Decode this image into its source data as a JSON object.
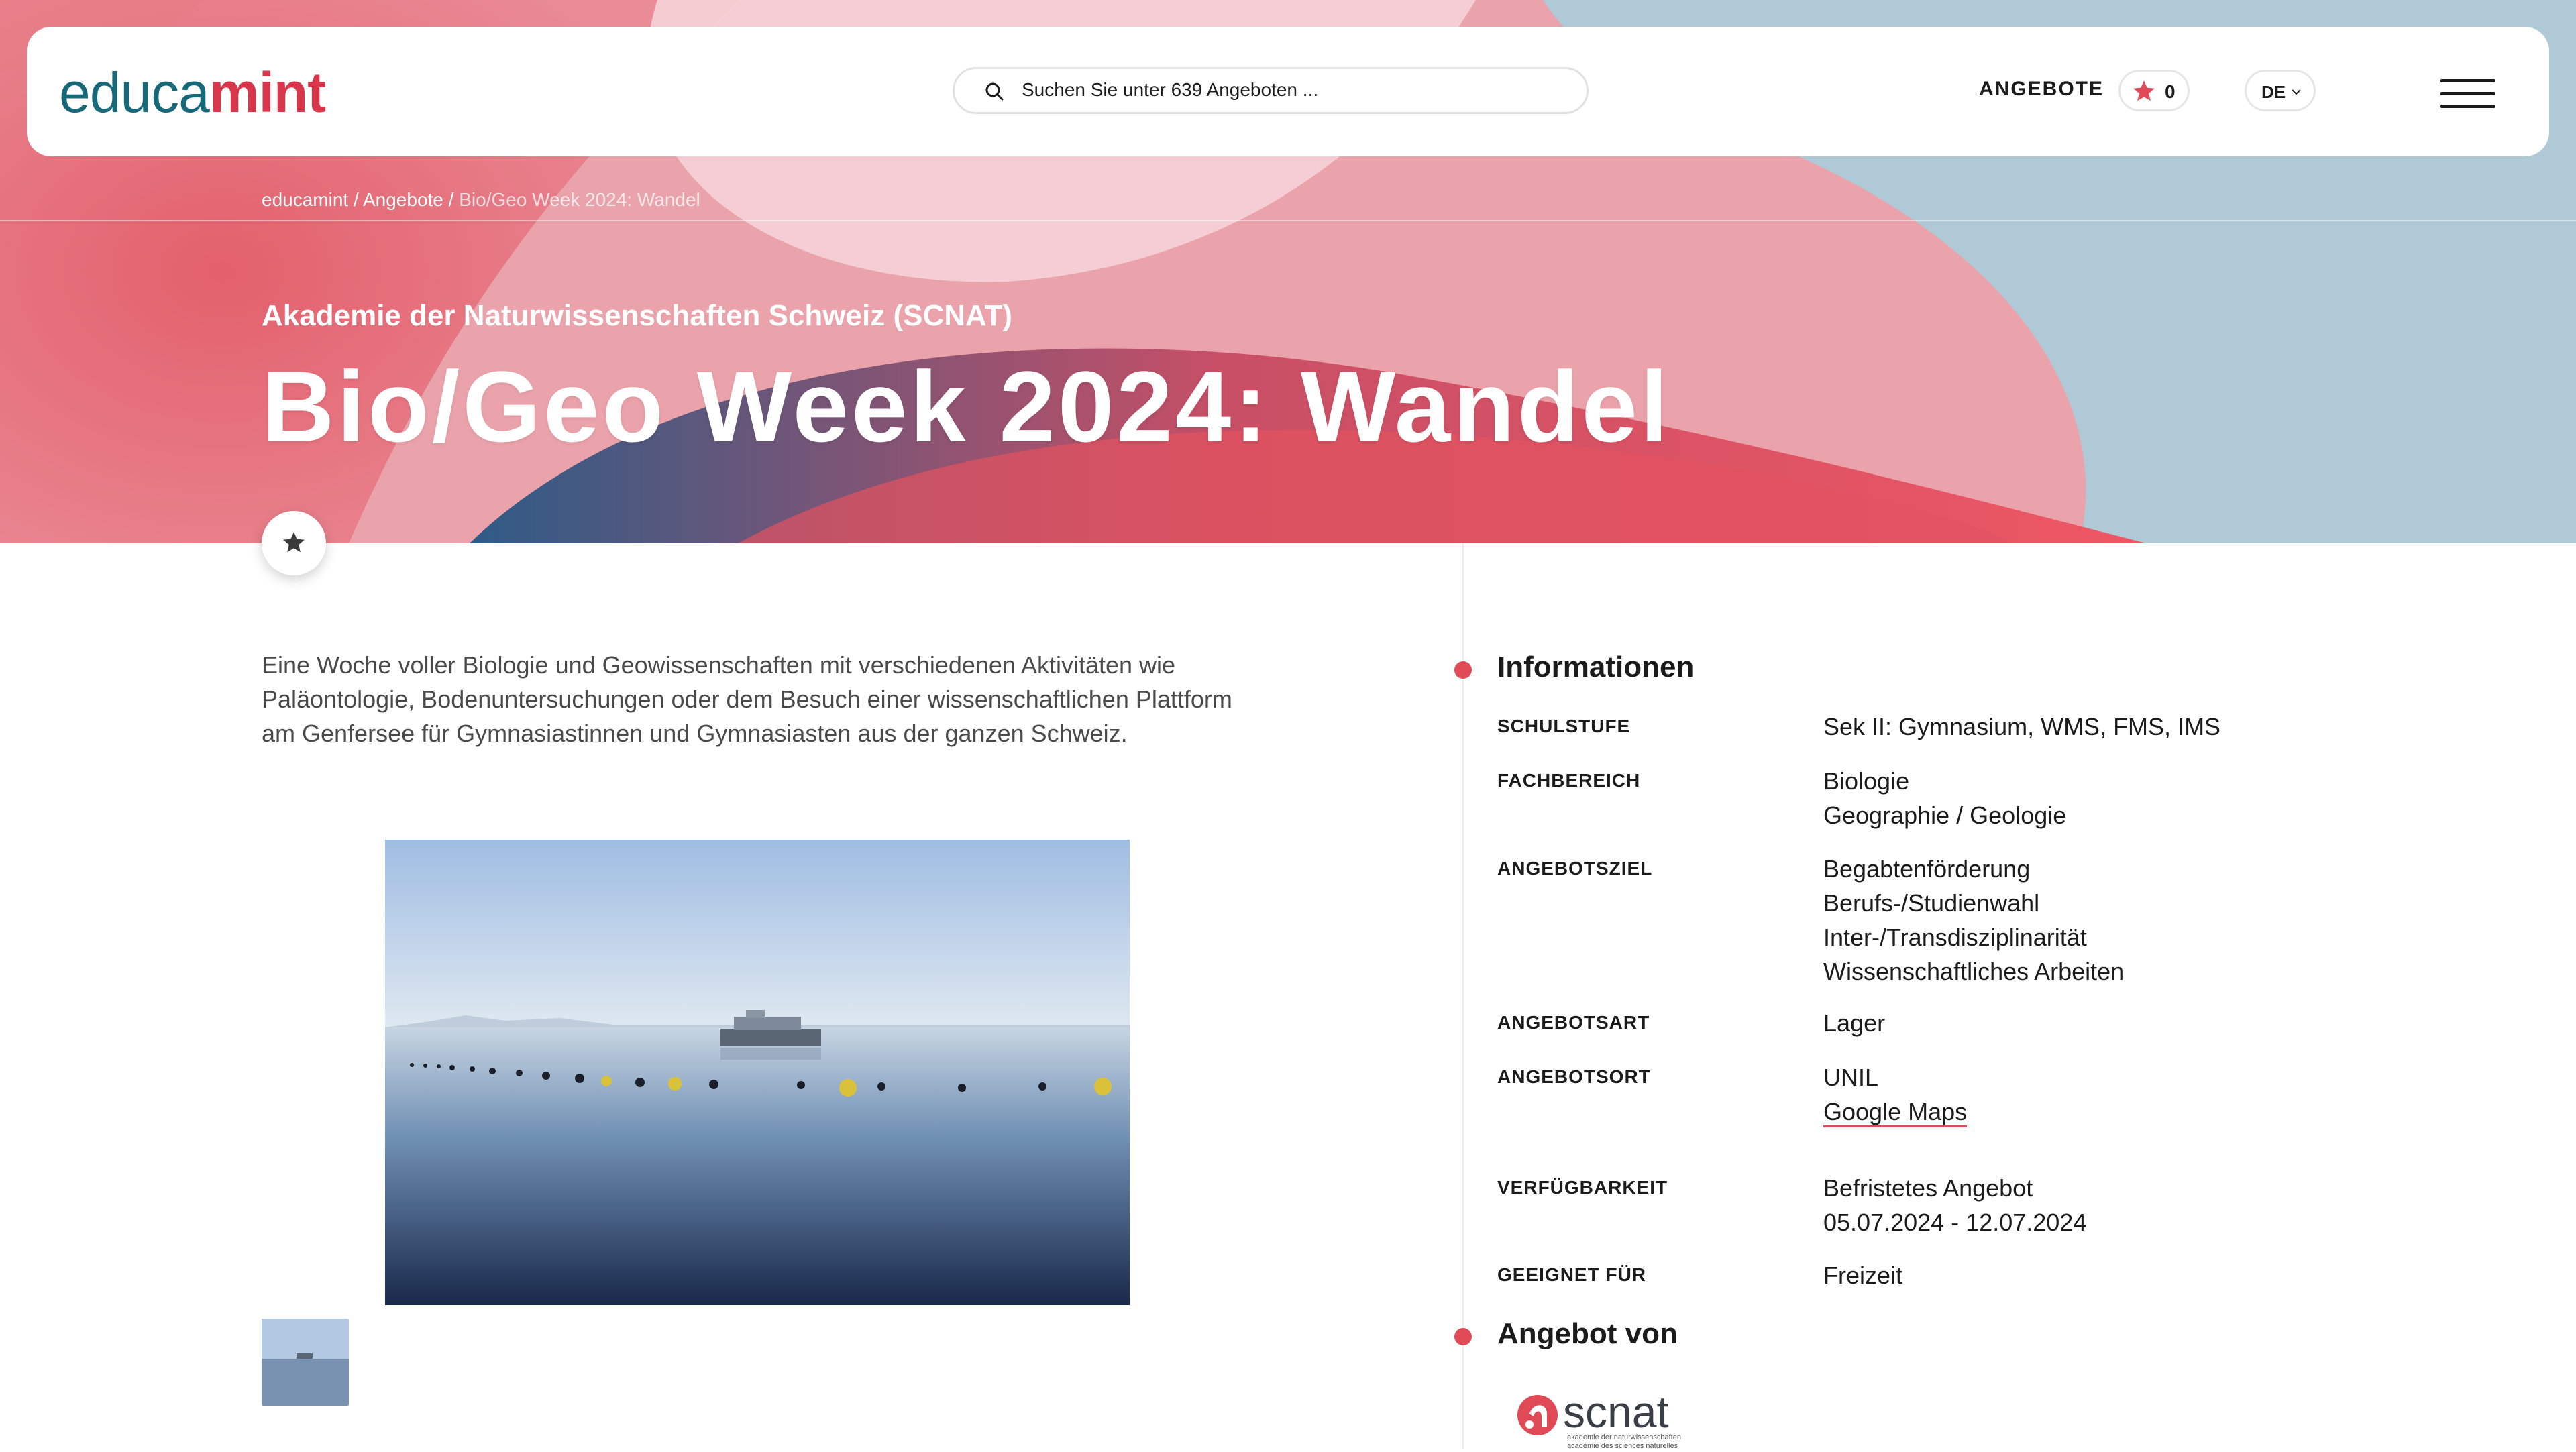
{
  "header": {
    "logo_part1": "educa",
    "logo_part2": "mint",
    "search_placeholder": "Suchen Sie unter 639 Angeboten ...",
    "nav_angebote": "ANGEBOTE",
    "favorites_count": "0",
    "language": "DE"
  },
  "breadcrumb": {
    "items": [
      "educamint",
      "Angebote",
      "Bio/Geo Week 2024: Wandel"
    ],
    "separator": "/"
  },
  "hero": {
    "provider": "Akademie der Naturwissenschaften Schweiz (SCNAT)",
    "title": "Bio/Geo Week 2024: Wandel"
  },
  "description": "Eine Woche voller Biologie und Geowissenschaften mit verschiedenen Aktivitäten wie Paläontologie, Bodenuntersuchungen oder dem Besuch einer wissenschaftlichen Plattform am Genfersee für Gymnasiastinnen und Gymnasiasten aus der ganzen Schweiz.",
  "info": {
    "title": "Informationen",
    "rows": [
      {
        "label": "SCHULSTUFE",
        "values": [
          "Sek II: Gymnasium, WMS, FMS, IMS"
        ]
      },
      {
        "label": "FACHBEREICH",
        "values": [
          "Biologie",
          "Geographie / Geologie"
        ]
      },
      {
        "label": "ANGEBOTSZIEL",
        "values": [
          "Begabtenförderung",
          "Berufs-/Studienwahl",
          "Inter-/Transdisziplinarität",
          "Wissenschaftliches Arbeiten"
        ]
      },
      {
        "label": "ANGEBOTSART",
        "values": [
          "Lager"
        ]
      },
      {
        "label": "ANGEBOTSORT",
        "values": [
          "UNIL"
        ],
        "link": "Google Maps"
      },
      {
        "label": "VERFÜGBARKEIT",
        "values": [
          "Befristetes Angebot",
          "05.07.2024 - 12.07.2024"
        ]
      },
      {
        "label": "GEEIGNET FÜR",
        "values": [
          "Freizeit"
        ]
      }
    ]
  },
  "offered_by": {
    "title": "Angebot von",
    "logo_text": "scnat",
    "logo_sub1": "akademie der naturwissenschaften",
    "logo_sub2": "académie des sciences naturelles"
  },
  "colors": {
    "accent": "#e04a57",
    "logo_teal": "#17697a",
    "logo_red": "#d8364b"
  },
  "icons": [
    "search-icon",
    "star-icon",
    "chevron-down-icon",
    "menu-icon"
  ]
}
